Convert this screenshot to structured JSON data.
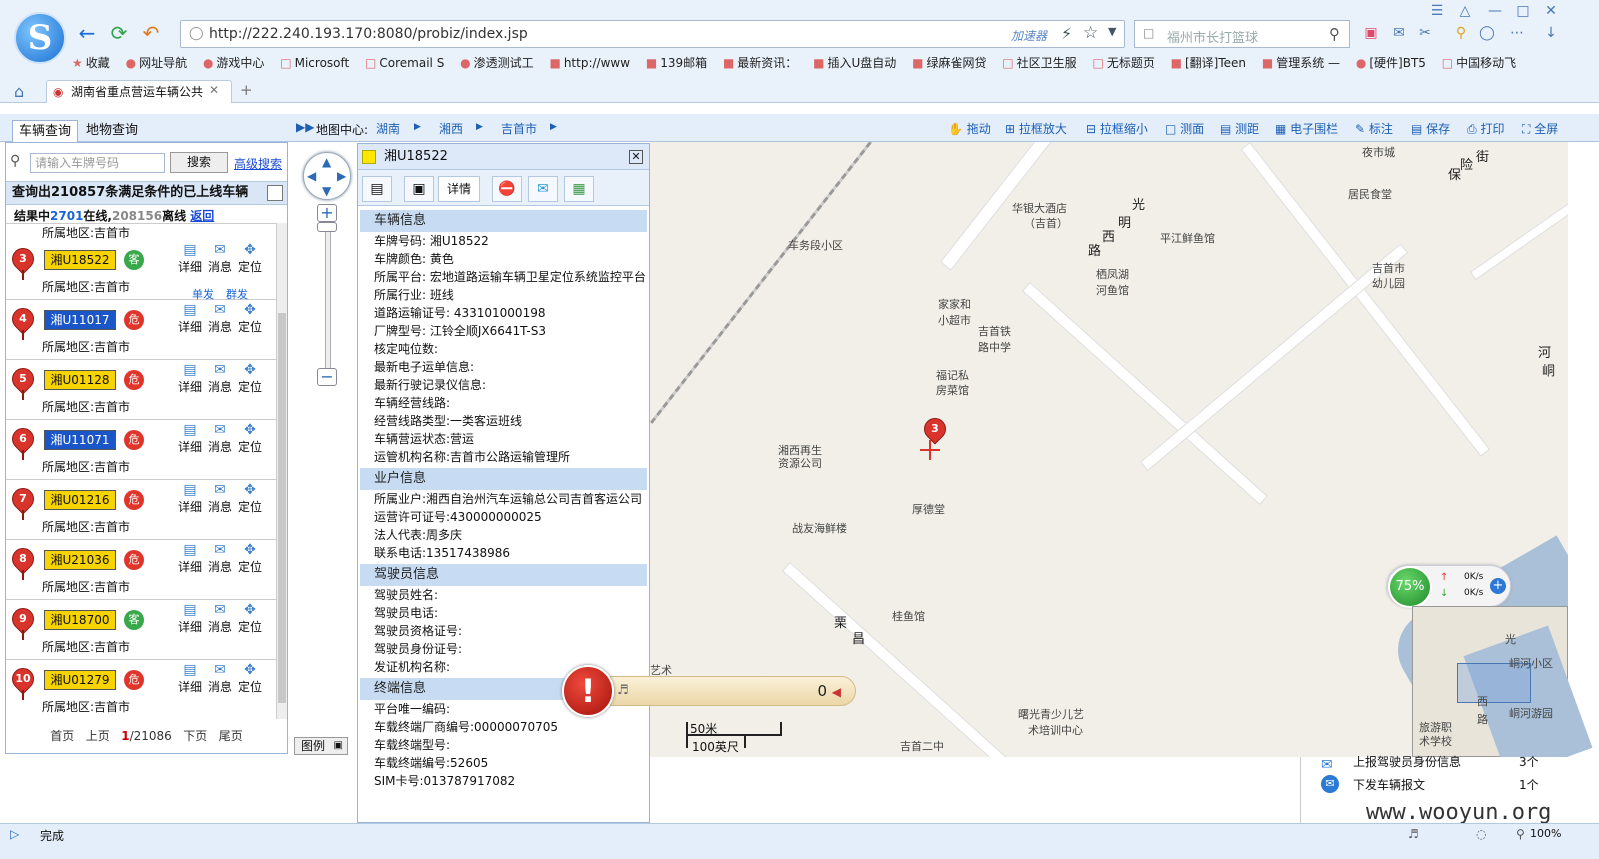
{
  "browser": {
    "url": "http://222.240.193.170:8080/probiz/index.jsp",
    "accelerator": "加速器",
    "search_placeholder": "福州市长打篮球",
    "bookmarks": [
      "收藏",
      "网址导航",
      "游戏中心",
      "Microsoft",
      "Coremail S",
      "渗透测试工",
      "http://www",
      "139邮箱",
      "最新资讯：",
      "插入U盘自动",
      "绿麻雀网贷",
      "社区卫生服",
      "无标题页",
      "[翻译]Teen",
      "管理系统 —",
      "[硬件]BT5",
      "中国移动飞"
    ],
    "tab_title": "湖南省重点营运车辆公共",
    "status_text": "完成",
    "zoom": "100%"
  },
  "app": {
    "tabs": [
      "车辆查询",
      "地物查询"
    ],
    "map_center_label": "地图中心:",
    "breadcrumb": [
      "湖南",
      "湘西",
      "吉首市"
    ],
    "tools": [
      "拖动",
      "拉框放大",
      "拉框缩小",
      "测面",
      "测距",
      "电子围栏",
      "标注",
      "保存",
      "打印",
      "全屏"
    ]
  },
  "left": {
    "search_placeholder": "请输入车牌号码",
    "search_button": "搜索",
    "advanced": "高级搜索",
    "query_text": "查询出210857条满足条件的已上线车辆",
    "result_prefix": "结果中",
    "online": "2701",
    "online_suffix": "在线,",
    "offline": "208156",
    "offline_suffix": "离线",
    "back": "返回",
    "partial_region": "所属地区:吉首市",
    "region_text": "所属地区:吉首市",
    "actions": [
      "详细",
      "消息",
      "定位"
    ],
    "sub_actions": [
      "单发",
      "群发"
    ],
    "vehicles": [
      {
        "n": "3",
        "plate": "湘U18522",
        "color": "yellow",
        "type": "客",
        "kind": "bus"
      },
      {
        "n": "4",
        "plate": "湘U11017",
        "color": "blue",
        "type": "危",
        "kind": "danger"
      },
      {
        "n": "5",
        "plate": "湘U01128",
        "color": "yellow",
        "type": "危",
        "kind": "danger"
      },
      {
        "n": "6",
        "plate": "湘U11071",
        "color": "blue",
        "type": "危",
        "kind": "danger"
      },
      {
        "n": "7",
        "plate": "湘U01216",
        "color": "yellow",
        "type": "危",
        "kind": "danger"
      },
      {
        "n": "8",
        "plate": "湘U21036",
        "color": "yellow",
        "type": "危",
        "kind": "danger"
      },
      {
        "n": "9",
        "plate": "湘U18700",
        "color": "yellow",
        "type": "客",
        "kind": "bus"
      },
      {
        "n": "10",
        "plate": "湘U01279",
        "color": "yellow",
        "type": "危",
        "kind": "danger"
      }
    ],
    "pager": {
      "first": "首页",
      "prev": "上页",
      "current": "1",
      "total": "/21086",
      "next": "下页",
      "last": "尾页"
    },
    "legend": "图例"
  },
  "info": {
    "title": "湘U18522",
    "detail_tab": "详情",
    "sections": [
      {
        "title": "车辆信息",
        "fields": [
          "车牌号码: 湘U18522",
          "车牌颜色: 黄色",
          "所属平台: 宏地道路运输车辆卫星定位系统监控平台",
          "所属行业: 班线",
          "道路运输证号: 433101000198",
          "厂牌型号: 江铃全顺JX6641T-S3",
          "核定吨位数:",
          "最新电子运单信息:",
          "最新行驶记录仪信息:",
          "车辆经营线路:",
          "经营线路类型:一类客运班线",
          "车辆营运状态:营运",
          "运管机构名称:吉首市公路运输管理所"
        ]
      },
      {
        "title": "业户信息",
        "fields": [
          "所属业户:湘西自治州汽车运输总公司吉首客运公司",
          "运营许可证号:430000000025",
          "法人代表:周多庆",
          "联系电话:13517438986"
        ]
      },
      {
        "title": "驾驶员信息",
        "fields": [
          "驾驶员姓名:",
          "驾驶员电话:",
          "驾驶员资格证号:",
          "驾驶员身份证号:",
          "发证机构名称:"
        ]
      },
      {
        "title": "终端信息",
        "fields": [
          "平台唯一编码:",
          "车载终端厂商编号:00000070705",
          "车载终端型号:",
          "车载终端编号:52605",
          "SIM卡号:013787917082"
        ]
      }
    ]
  },
  "map": {
    "labels": [
      "夜市城",
      "街",
      "险",
      "保",
      "居民食堂",
      "华银大酒店",
      "（吉首）",
      "光",
      "明",
      "西",
      "路",
      "平江鲜鱼馆",
      "车务段小区",
      "栖凤湖",
      "河鱼馆",
      "吉首市",
      "幼儿园",
      "家家和",
      "小超市",
      "吉首铁",
      "路中学",
      "福记私",
      "房菜馆",
      "湘西再生",
      "资源公司",
      "厚德堂",
      "战友海鲜楼",
      "桂鱼馆",
      "栗",
      "昌",
      "曙光青少儿艺",
      "术培训中心",
      "吉首二中",
      "艺术",
      "峒",
      "河"
    ],
    "marker": "3",
    "scale_m": "50米",
    "scale_ft": "100英尺",
    "minimap_labels": [
      "旅游职",
      "术学校",
      "峒河小区",
      "峒河游园",
      "西",
      "路",
      "光"
    ]
  },
  "alarm": {
    "count": "0"
  },
  "net": {
    "percent": "75%",
    "up": "0K/s",
    "down": "0K/s"
  },
  "notify": [
    {
      "text": "上报驾驶员身份信息",
      "count": "3个"
    },
    {
      "text": "下发车辆报文",
      "count": "1个"
    }
  ],
  "watermark": "www.wooyun.org"
}
